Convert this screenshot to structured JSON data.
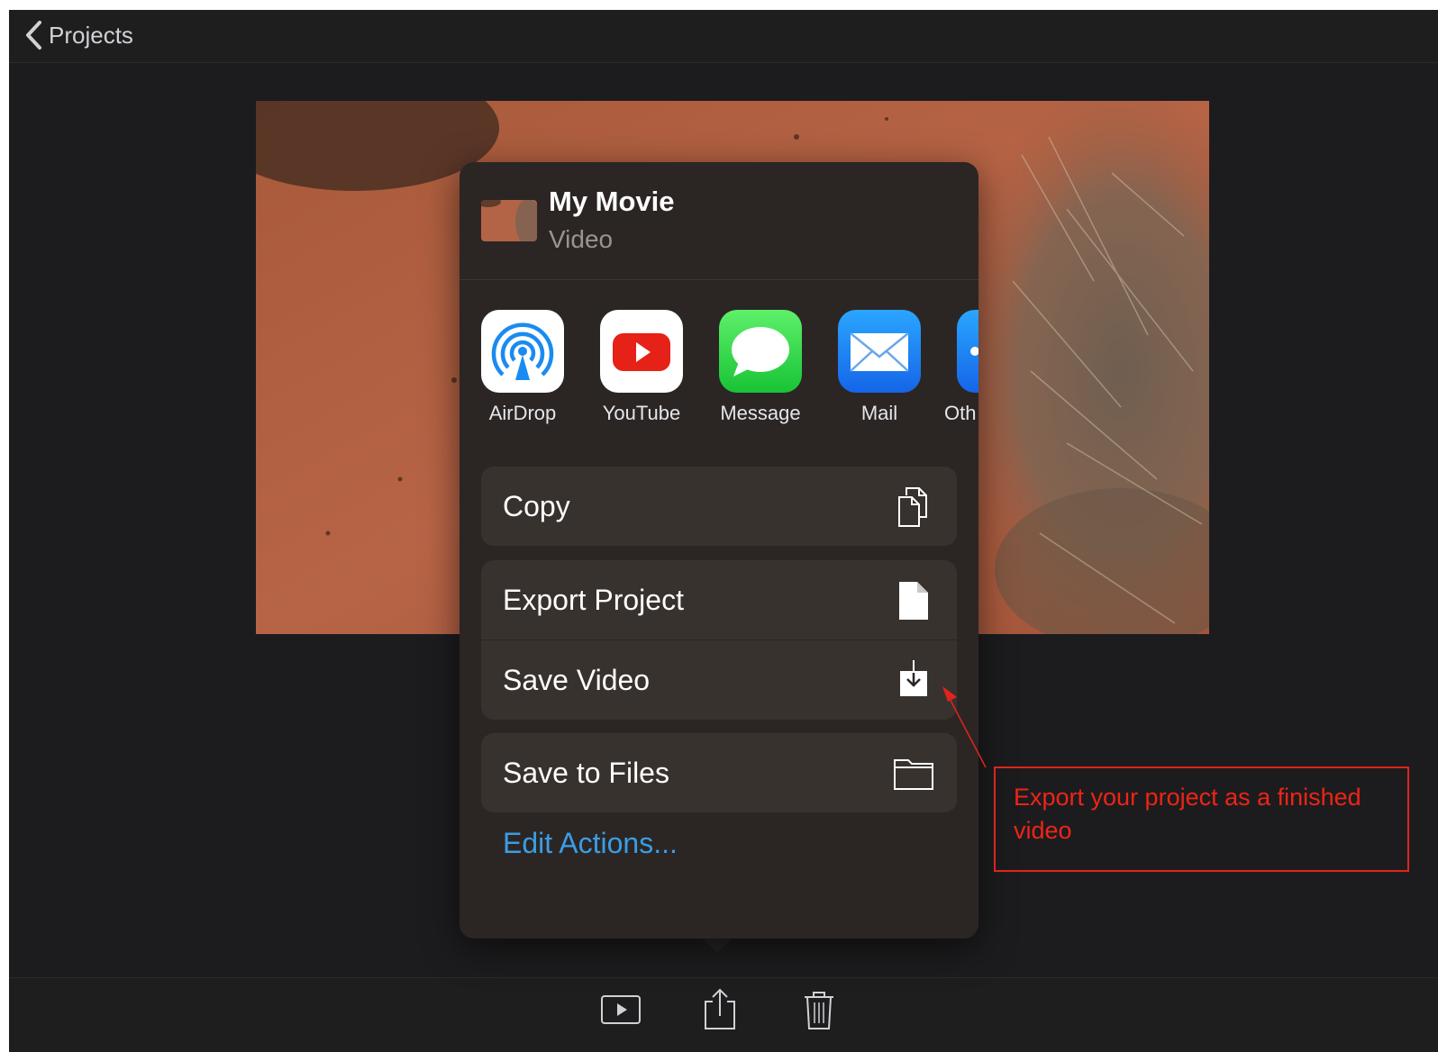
{
  "topbar": {
    "back_label": "Projects"
  },
  "share_sheet": {
    "title": "My Movie",
    "subtitle": "Video",
    "apps": [
      {
        "label": "AirDrop",
        "icon": "airdrop-icon"
      },
      {
        "label": "YouTube",
        "icon": "youtube-icon"
      },
      {
        "label": "Message",
        "icon": "message-icon"
      },
      {
        "label": "Mail",
        "icon": "mail-icon"
      },
      {
        "label": "Oth",
        "icon": "other-icon"
      }
    ],
    "actions": {
      "copy": "Copy",
      "export_project": "Export Project",
      "save_video": "Save Video",
      "save_to_files": "Save to Files"
    },
    "edit_actions": "Edit Actions..."
  },
  "toolbar": {
    "icons": [
      "play-icon",
      "share-icon",
      "trash-icon"
    ]
  },
  "annotation": {
    "text": "Export your project as a finished video",
    "color": "#e0241b"
  },
  "colors": {
    "accent": "#3a9de6",
    "sheet_bg": "#2b2624",
    "row_bg": "#38322f"
  }
}
